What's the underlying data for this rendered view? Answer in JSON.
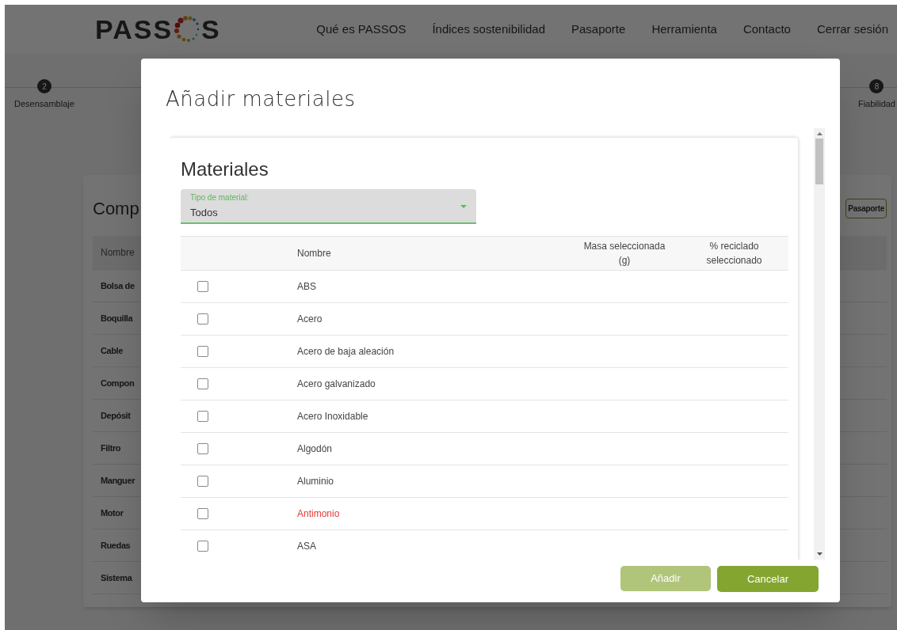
{
  "header": {
    "logo": {
      "text_before": "PASS",
      "text_after": "S"
    },
    "nav": [
      "Qué es PASSOS",
      "Índices sostenibilidad",
      "Pasaporte",
      "Herramienta",
      "Contacto",
      "Cerrar sesión"
    ]
  },
  "stepper": [
    {
      "number": "2",
      "label": "Desensamblaje"
    },
    {
      "number": "8",
      "label": "Fiabilidad"
    }
  ],
  "background_card": {
    "title": "Comp",
    "button": "Pasaporte",
    "column": "Nombre",
    "rows": [
      "Bolsa de",
      "Boquilla",
      "Cable",
      "Compon",
      "Depósit",
      "Filtro",
      "Manguer",
      "Motor",
      "Ruedas",
      "Sistema"
    ]
  },
  "dialog": {
    "title": "Añadir materiales",
    "section_title": "Materiales",
    "filter": {
      "label": "Tipo de material:",
      "value": "Todos"
    },
    "columns": [
      "Nombre",
      "Masa seleccionada (g)",
      "% reciclado seleccionado"
    ],
    "rows": [
      {
        "name": "ABS",
        "checked": false,
        "flagged": false
      },
      {
        "name": "Acero",
        "checked": false,
        "flagged": false
      },
      {
        "name": "Acero de baja aleación",
        "checked": false,
        "flagged": false
      },
      {
        "name": "Acero galvanizado",
        "checked": false,
        "flagged": false
      },
      {
        "name": "Acero Inoxidable",
        "checked": false,
        "flagged": false
      },
      {
        "name": "Algodón",
        "checked": false,
        "flagged": false
      },
      {
        "name": "Aluminio",
        "checked": false,
        "flagged": false
      },
      {
        "name": "Antimonio",
        "checked": false,
        "flagged": true
      },
      {
        "name": "ASA",
        "checked": false,
        "flagged": false
      }
    ],
    "buttons": [
      {
        "label": "Añadir",
        "disabled": true
      },
      {
        "label": "Cancelar",
        "disabled": false
      }
    ]
  }
}
